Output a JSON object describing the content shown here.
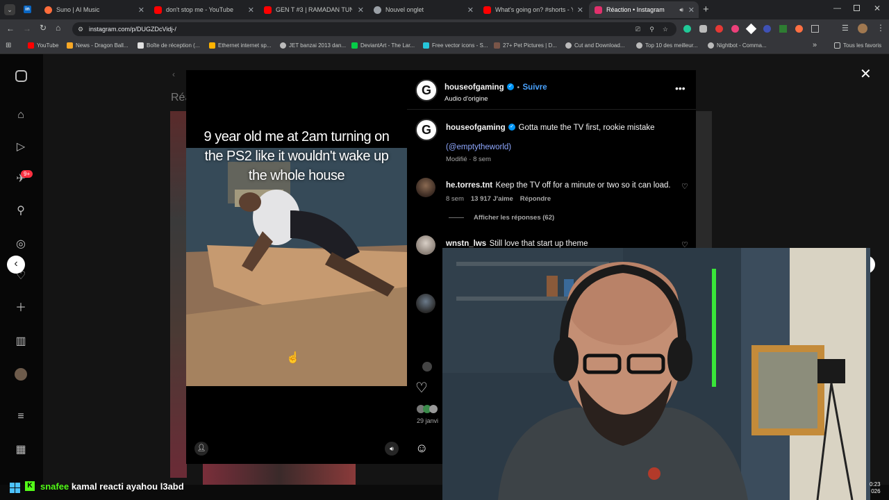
{
  "tabs": [
    {
      "label": "Suno | AI Music",
      "color": "#ff6d3b"
    },
    {
      "label": "don't stop me - YouTube",
      "color": "#ff0000"
    },
    {
      "label": "GEN T #3 | RAMADAN TUNISIA",
      "color": "#ff0000"
    },
    {
      "label": "Nouvel onglet",
      "color": "#9aa0a6"
    },
    {
      "label": "What's going on? #shorts - You",
      "color": "#ff0000"
    },
    {
      "label": "Réaction • Instagram",
      "color": "#e1306c"
    }
  ],
  "url": "instagram.com/p/DUGZDcVidj-/",
  "bookmarks": [
    "YouTube",
    "News - Dragon Ball...",
    "Boîte de réception (...",
    "Ethernet internet sp...",
    "JET banzai 2013 dan...",
    "DeviantArt - The Lar...",
    "Free vector icons - S...",
    "27+ Pet Pictures | D...",
    "Cut and Download...",
    "Top 10 des meilleur...",
    "Nightbot - Comma...",
    "Tous les favoris"
  ],
  "nav_badge": "9+",
  "bg_title": "Réa",
  "video": {
    "caption": "9 year old me at 2am turning on the PS2 like it wouldn't wake up the whole house"
  },
  "post": {
    "author": "houseofgaming",
    "follow": "Suivre",
    "audio": "Audio d'origine",
    "caption_text": "Gotta mute the TV first, rookie mistake",
    "mention": "(@emptytheworld)",
    "meta": "Modifié · 8 sem",
    "date": "29 janvi"
  },
  "comments": [
    {
      "user": "he.torres.tnt",
      "text": "Keep the TV off for a minute or two so it can load.",
      "age": "8 sem",
      "likes": "13 917 J'aime",
      "reply": "Répondre",
      "replies": "Afficher les réponses (62)"
    },
    {
      "user": "wnstn_lws",
      "text": "Still love that start up theme"
    }
  ],
  "overlay_chat": {
    "user": "snafee",
    "text": "kamal reacti ayahou l3abd"
  },
  "clock": {
    "time": "0:23",
    "date": "026"
  }
}
